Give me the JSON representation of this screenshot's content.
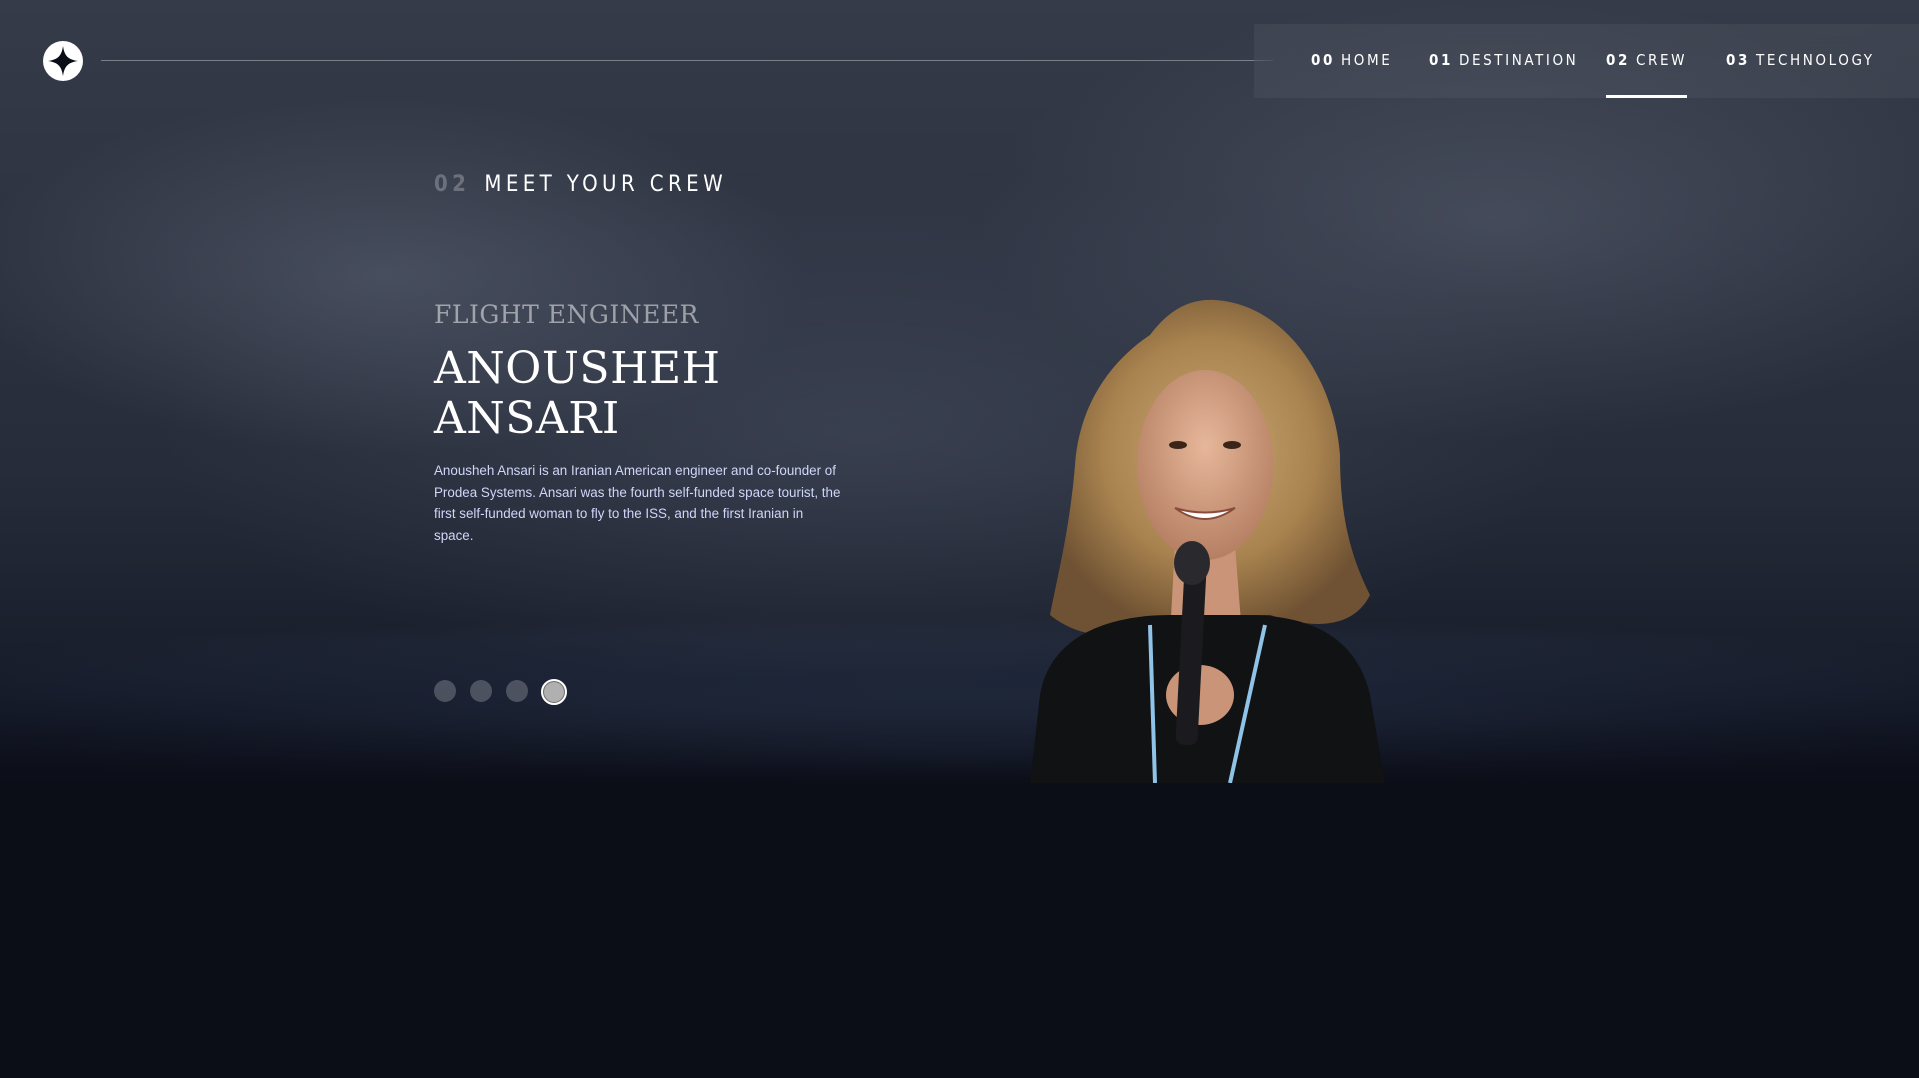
{
  "nav": {
    "items": [
      {
        "num": "00",
        "label": "HOME",
        "active": false
      },
      {
        "num": "01",
        "label": "DESTINATION",
        "active": false
      },
      {
        "num": "02",
        "label": "CREW",
        "active": true
      },
      {
        "num": "03",
        "label": "TECHNOLOGY",
        "active": false
      }
    ]
  },
  "section": {
    "num": "02",
    "title": "MEET YOUR CREW"
  },
  "crew": {
    "role": "FLIGHT ENGINEER",
    "name_line1": "ANOUSHEH",
    "name_line2": "ANSARI",
    "bio": "Anousheh Ansari is an Iranian American engineer and co-founder of Prodea Systems. Ansari was the fourth self-funded space tourist, the first self-funded woman to fly to the ISS, and the first Iranian in space."
  },
  "pagination": {
    "count": 4,
    "active_index": 3
  },
  "icons": {
    "logo": "star-logo-icon"
  },
  "colors": {
    "background": "#0b0d17",
    "text": "#ffffff",
    "body_text": "#d0d6f9",
    "muted": "#7f818b"
  }
}
